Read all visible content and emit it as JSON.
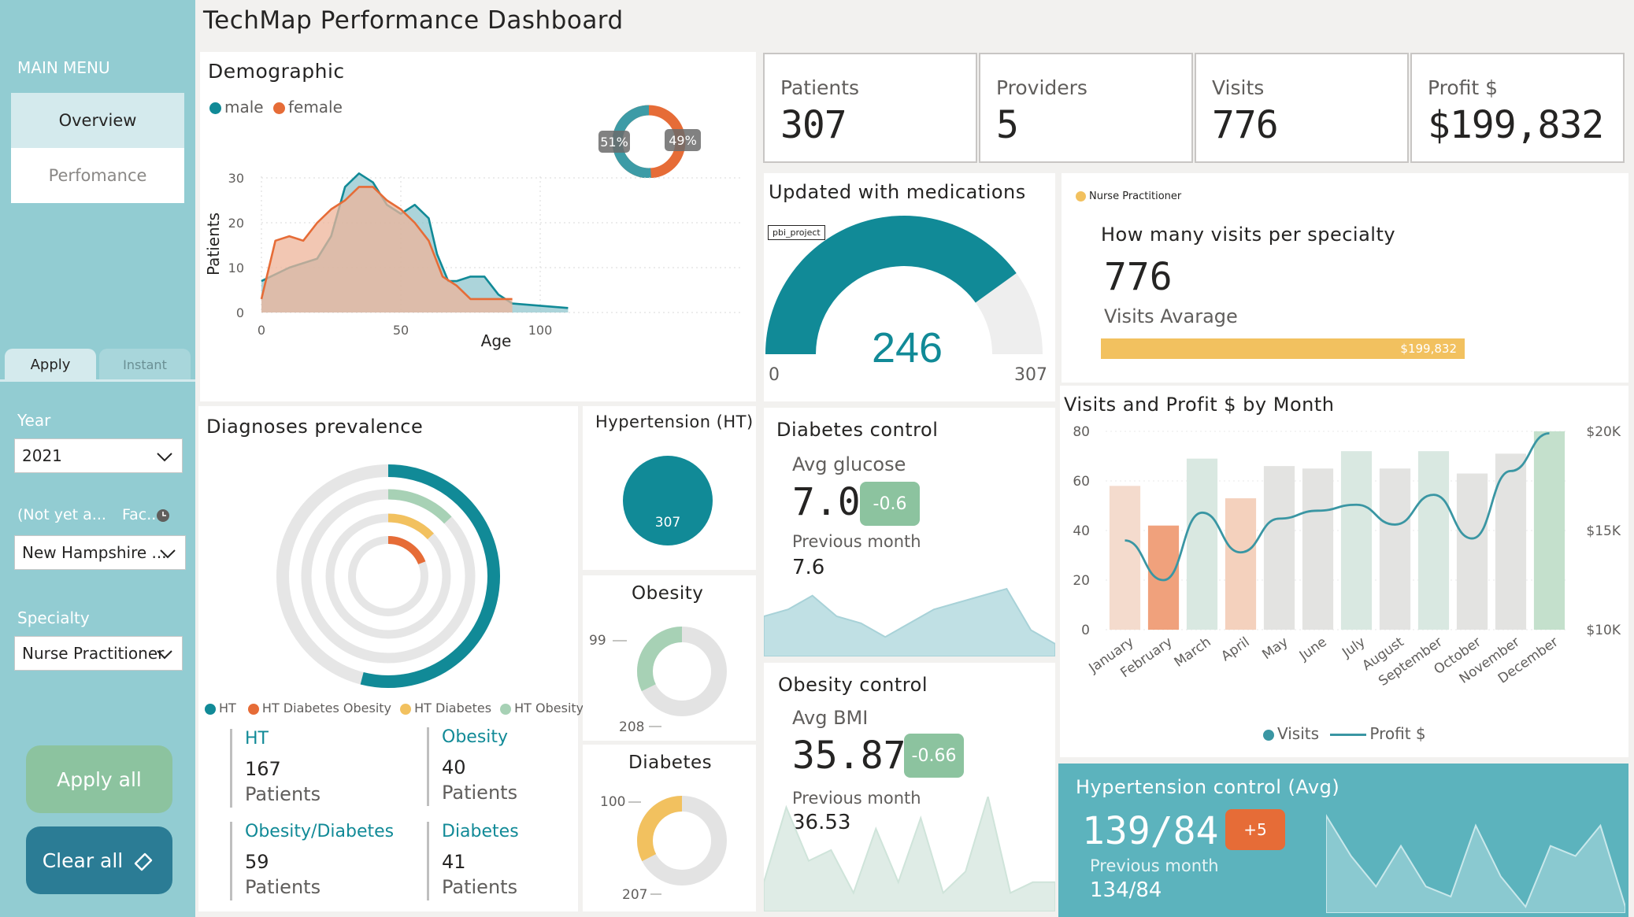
{
  "page_title": "TechMap Performance Dashboard",
  "sidebar": {
    "heading": "MAIN MENU",
    "nav": [
      {
        "label": "Overview"
      },
      {
        "label": "Perfomance"
      }
    ],
    "tabs": [
      {
        "label": "Apply"
      },
      {
        "label": "Instant"
      }
    ],
    "filters": {
      "year_label": "Year",
      "year_value": "2021",
      "facility_label": "(Not yet a...",
      "facility_label2": "Fac...",
      "facility_value": "New Hampshire ...",
      "specialty_label": "Specialty",
      "specialty_value": "Nurse Practitioner"
    },
    "apply_all": "Apply all",
    "clear_all": "Clear all"
  },
  "demographic": {
    "title": "Demographic",
    "legend": [
      {
        "label": "male",
        "color": "#118a97"
      },
      {
        "label": "female",
        "color": "#e66c37"
      }
    ],
    "donut": {
      "male_pct": "51%",
      "female_pct": "49%",
      "male": 51,
      "female": 49
    },
    "chart_data": {
      "type": "area",
      "xlabel": "Age",
      "ylabel": "Patients",
      "xlim": [
        0,
        110
      ],
      "ylim": [
        0,
        33
      ],
      "x_ticks": [
        "0",
        "50",
        "100"
      ],
      "y_ticks": [
        "0",
        "10",
        "20",
        "30"
      ],
      "series": [
        {
          "name": "male",
          "color": "#118a97",
          "x": [
            0,
            10,
            20,
            25,
            30,
            35,
            40,
            45,
            50,
            55,
            60,
            63,
            67,
            70,
            75,
            80,
            85,
            90,
            100,
            110
          ],
          "y": [
            7,
            10,
            12,
            17,
            28,
            31,
            29,
            24,
            22,
            24,
            21,
            13,
            7,
            7,
            8,
            8,
            4,
            2,
            1.5,
            1
          ]
        },
        {
          "name": "female",
          "color": "#e66c37",
          "x": [
            0,
            5,
            10,
            15,
            20,
            25,
            30,
            35,
            40,
            45,
            50,
            55,
            60,
            65,
            70,
            75,
            80,
            85,
            90
          ],
          "y": [
            3,
            16,
            17,
            16,
            20,
            23,
            25,
            28,
            28,
            25,
            23,
            20,
            16,
            8,
            6,
            3,
            3,
            3,
            3
          ]
        }
      ]
    }
  },
  "kpis": [
    {
      "label": "Patients",
      "value": "307"
    },
    {
      "label": "Providers",
      "value": "5"
    },
    {
      "label": "Visits",
      "value": "776"
    },
    {
      "label": "Profit $",
      "value": "$199,832"
    }
  ],
  "medications": {
    "title": "Updated with medications",
    "tag": "pbi_project",
    "value": "246",
    "min": "0",
    "max": "307",
    "fraction": 0.801
  },
  "specialty_visits": {
    "legend_label": "Nurse Practitioner",
    "legend_color": "#f2c15f",
    "title": "How many visits per specialty",
    "value": "776",
    "subtitle": "Visits Avarage",
    "bar_label": "$199,832"
  },
  "diagnoses": {
    "title": "Diagnoses prevalence",
    "rings": [
      {
        "name": "HT",
        "value": 167,
        "color": "#118a97"
      },
      {
        "name": "HT Obesity",
        "value": 40,
        "color": "#a7d1b5"
      },
      {
        "name": "HT Diabetes",
        "value": 41,
        "color": "#f2c15f"
      },
      {
        "name": "HT Diabetes Obesity",
        "value": 59,
        "color": "#e66c37"
      }
    ],
    "ring_fractions": [
      0.54,
      0.13,
      0.13,
      0.19
    ],
    "legend": [
      {
        "label": "HT",
        "color": "#118a97"
      },
      {
        "label": "HT Diabetes Obesity",
        "color": "#e66c37"
      },
      {
        "label": "HT Diabetes",
        "color": "#f2c15f"
      },
      {
        "label": "HT  Obesity",
        "color": "#a7d1b5"
      }
    ],
    "stats": [
      {
        "heading": "HT",
        "number": "167",
        "unit": "Patients"
      },
      {
        "heading": "Obesity",
        "number": "40",
        "unit": "Patients"
      },
      {
        "heading": "Obesity/Diabetes",
        "number": "59",
        "unit": "Patients"
      },
      {
        "heading": "Diabetes",
        "number": "41",
        "unit": "Patients"
      }
    ]
  },
  "hypertension_card": {
    "title": "Hypertension (HT)",
    "value": "307",
    "color": "#118a97"
  },
  "obesity_card": {
    "title": "Obesity",
    "top": "99",
    "bottom": "208",
    "top_value": 99,
    "bottom_value": 208,
    "color": "#a7d1b5"
  },
  "diabetes_card": {
    "title": "Diabetes",
    "top": "100",
    "bottom": "207",
    "top_value": 100,
    "bottom_value": 207,
    "color": "#f2c15f"
  },
  "diabetes_control": {
    "title": "Diabetes control",
    "metric_label": "Avg glucose",
    "value": "7.0",
    "delta": "-0.6",
    "prev_label": "Previous month",
    "prev_value": "7.6",
    "sparkline": [
      4,
      5,
      7,
      4,
      3,
      1,
      3,
      5,
      6,
      7,
      8,
      2,
      0
    ]
  },
  "obesity_control": {
    "title": "Obesity control",
    "metric_label": "Avg BMI",
    "value": "35.87",
    "delta": "-0.66",
    "prev_label": "Previous month",
    "prev_value": "36.53",
    "sparkline": [
      2,
      9,
      4,
      5,
      1,
      7,
      2,
      8,
      1,
      3,
      10,
      1,
      2,
      2
    ]
  },
  "hypertension_control": {
    "title": "Hypertension control (Avg)",
    "value": "139/84",
    "delta": "+5",
    "prev_label": "Previous month",
    "prev_value": "134/84",
    "sparkline": [
      9,
      5,
      2,
      6,
      2,
      1,
      8,
      3,
      0,
      6,
      5,
      8,
      0
    ]
  },
  "monthly": {
    "title": "Visits and Profit $ by Month",
    "chart_data": {
      "type": "bar",
      "categories": [
        "January",
        "February",
        "March",
        "April",
        "May",
        "June",
        "July",
        "August",
        "September",
        "October",
        "November",
        "December"
      ],
      "series": [
        {
          "name": "Visits",
          "axis": "left",
          "values": [
            58,
            42,
            69,
            53,
            66,
            65,
            72,
            65,
            72,
            63,
            71,
            80
          ]
        },
        {
          "name": "Profit $",
          "axis": "right",
          "values": [
            14.5,
            12.5,
            15.9,
            13.9,
            15.6,
            16.0,
            16.3,
            15.3,
            16.8,
            14.6,
            18.0,
            19.9
          ]
        }
      ],
      "bar_colors": [
        "#f4dbcd",
        "#f0a17c",
        "#d9e8e1",
        "#f4d1bd",
        "#e3e3e1",
        "#e3e3e1",
        "#d9e8e1",
        "#e3e3e1",
        "#d9e8e1",
        "#e3e3e1",
        "#e3e3e1",
        "#c4e0cc"
      ],
      "line_color": "#3a96a3",
      "ylim_left": [
        0,
        80
      ],
      "ylim_right": [
        10,
        20
      ],
      "y_left_ticks": [
        "0",
        "20",
        "40",
        "60",
        "80"
      ],
      "y_right_ticks": [
        "$10K",
        "$15K",
        "$20K"
      ],
      "legend": [
        {
          "label": "Visits",
          "kind": "dot",
          "color": "#3a96a3"
        },
        {
          "label": "Profit $",
          "kind": "line",
          "color": "#3a96a3"
        }
      ]
    }
  }
}
